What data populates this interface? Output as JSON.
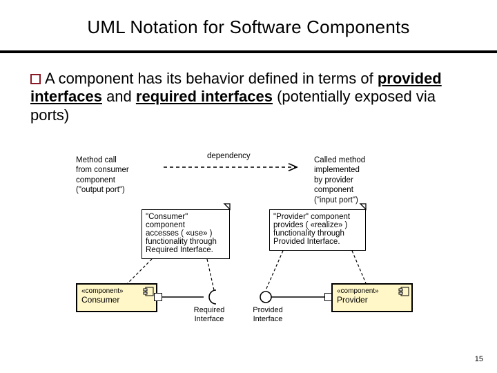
{
  "title": "UML Notation for Software Components",
  "bullet": {
    "pre": "A component has its behavior defined in terms of ",
    "b1": "provided interfaces",
    "mid": " and ",
    "b2": "required interfaces",
    "post": " (potentially exposed via ports)"
  },
  "dep_label": "dependency",
  "left_port_note": "Method call\nfrom consumer\ncomponent\n(\"output port\")",
  "right_port_note": "Called method\nimplemented\nby provider\ncomponent\n(\"input port\")",
  "consumer_note": "\"Consumer\"\ncomponent\naccesses ( «use» )\nfunctionality through\nRequired Interface.",
  "provider_note": "\"Provider\" component\nprovides ( «realize» )\nfunctionality through\nProvided Interface.",
  "consumer": {
    "stereo": "«component»",
    "name": "Consumer"
  },
  "provider": {
    "stereo": "«component»",
    "name": "Provider"
  },
  "req_if": "Required\nInterface",
  "prov_if": "Provided\nInterface",
  "page": "15"
}
